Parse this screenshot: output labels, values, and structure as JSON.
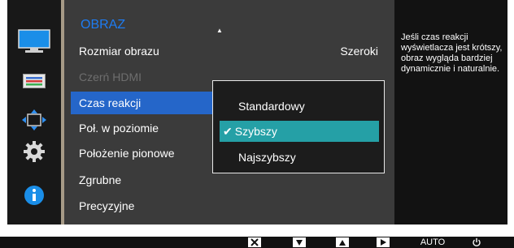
{
  "menu": {
    "title": "OBRAZ",
    "items": [
      {
        "label": "Rozmiar obrazu",
        "value": "Szeroki"
      },
      {
        "label": "Czerń HDMI"
      },
      {
        "label": "Czas reakcji"
      },
      {
        "label": "Poł. w poziomie"
      },
      {
        "label": "Położenie pionowe"
      },
      {
        "label": "Zgrubne"
      },
      {
        "label": "Precyzyjne"
      }
    ]
  },
  "popup": {
    "options": [
      {
        "label": "Standardowy"
      },
      {
        "label": "Szybszy",
        "selected": true
      },
      {
        "label": "Najszybszy"
      }
    ]
  },
  "help": {
    "text": "Jeśli czas reakcji wyświetlacza jest krótszy, obraz wygląda bardziej dynamicznie i naturalnie."
  },
  "sidebar": {
    "icons": [
      "monitor-icon",
      "settings-bars-icon",
      "resize-arrows-icon",
      "gear-icon",
      "info-icon"
    ]
  },
  "bottom_bar": {
    "buttons": [
      {
        "icon": "close-icon"
      },
      {
        "icon": "down-arrow-icon"
      },
      {
        "icon": "up-arrow-icon"
      },
      {
        "icon": "right-arrow-icon"
      },
      {
        "label": "AUTO"
      },
      {
        "icon": "power-icon"
      }
    ]
  },
  "colors": {
    "accent_title": "#1e7cf2",
    "selected_item": "#2566c9",
    "selected_option": "#25a0a6",
    "disabled_text": "#6e6e6e"
  }
}
